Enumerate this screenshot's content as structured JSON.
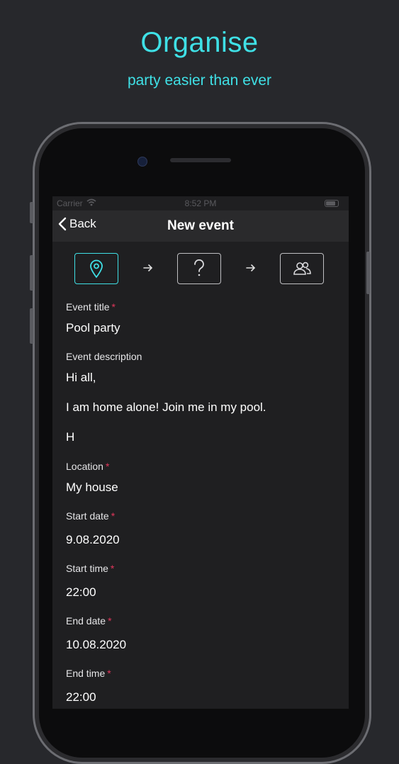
{
  "promo": {
    "headline": "Organise",
    "subline": "party easier than ever"
  },
  "status_bar": {
    "carrier": "Carrier",
    "time": "8:52 PM"
  },
  "nav": {
    "back_label": "Back",
    "title": "New event"
  },
  "steps": [
    {
      "icon": "location-pin-icon",
      "active": true
    },
    {
      "icon": "question-mark-icon",
      "active": false
    },
    {
      "icon": "people-icon",
      "active": false
    }
  ],
  "form": {
    "required_marker": "*",
    "event_title": {
      "label": "Event title",
      "value": "Pool party"
    },
    "event_description": {
      "label": "Event description",
      "lines": [
        "Hi all,",
        "I am home alone! Join me in my pool.",
        "H"
      ]
    },
    "location": {
      "label": "Location",
      "value": "My house"
    },
    "start_date": {
      "label": "Start date",
      "value": "9.08.2020"
    },
    "start_time": {
      "label": "Start time",
      "value": "22:00"
    },
    "end_date": {
      "label": "End date",
      "value": "10.08.2020"
    },
    "end_time": {
      "label": "End time",
      "value": "22:00"
    }
  },
  "colors": {
    "accent": "#3fe0e6",
    "required": "#e2365b",
    "background": "#27282c",
    "screen": "#1f1f21"
  }
}
